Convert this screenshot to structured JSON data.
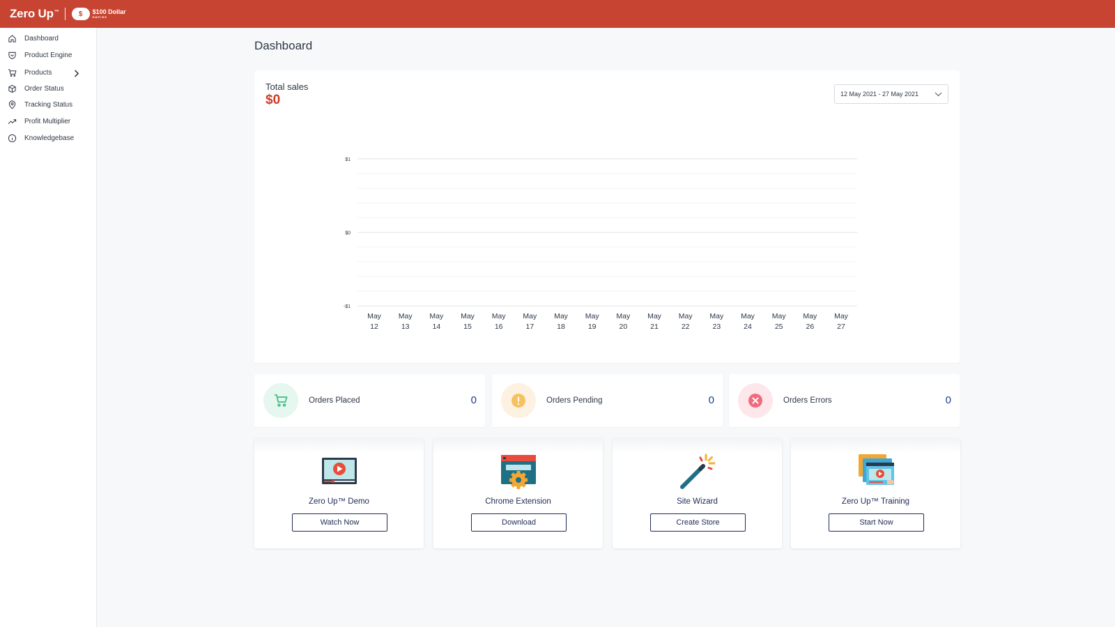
{
  "header": {
    "brand": "Zero Up",
    "brand_tm": "™",
    "partner_badge": "$",
    "partner_main": "$100 Dollar",
    "partner_sub": "EMPIRE",
    "bar_color": "#c84432"
  },
  "sidebar": {
    "items": [
      {
        "label": "Dashboard",
        "icon": "home-icon"
      },
      {
        "label": "Product Engine",
        "icon": "shield-icon"
      },
      {
        "label": "Products",
        "icon": "cart-icon"
      },
      {
        "label": "Order Status",
        "icon": "box-icon"
      },
      {
        "label": "Tracking Status",
        "icon": "location-pin-icon"
      },
      {
        "label": "Profit Multiplier",
        "icon": "trending-up-icon"
      },
      {
        "label": "Knowledgebase",
        "icon": "info-icon"
      }
    ]
  },
  "main": {
    "title": "Dashboard",
    "sales": {
      "label": "Total sales",
      "value": "$0",
      "date_range": "12 May 2021 - 27 May 2021"
    },
    "stats": [
      {
        "label": "Orders Placed",
        "value": "0",
        "icon": "cart-icon",
        "color": "#3fbf86",
        "bg": "#e6f7ef"
      },
      {
        "label": "Orders Pending",
        "value": "0",
        "icon": "exclamation-icon",
        "color": "#f3b750",
        "bg": "#fdf2e1"
      },
      {
        "label": "Orders Errors",
        "value": "0",
        "icon": "x-circle-icon",
        "color": "#f06c7d",
        "bg": "#fde7ea"
      }
    ],
    "features": [
      {
        "title": "Zero Up™ Demo",
        "button": "Watch Now",
        "icon": "video-player-icon"
      },
      {
        "title": "Chrome Extension",
        "button": "Download",
        "icon": "browser-gear-icon"
      },
      {
        "title": "Site Wizard",
        "button": "Create Store",
        "icon": "magic-wand-icon"
      },
      {
        "title": "Zero Up™ Training",
        "button": "Start Now",
        "icon": "training-video-icon"
      }
    ]
  },
  "chart_data": {
    "type": "line",
    "categories": [
      "May 12",
      "May 13",
      "May 14",
      "May 15",
      "May 16",
      "May 17",
      "May 18",
      "May 19",
      "May 20",
      "May 21",
      "May 22",
      "May 23",
      "May 24",
      "May 25",
      "May 26",
      "May 27"
    ],
    "series": [
      {
        "values": [
          0,
          0,
          0,
          0,
          0,
          0,
          0,
          0,
          0,
          0,
          0,
          0,
          0,
          0,
          0,
          0
        ]
      }
    ],
    "y_ticks": [
      "$1",
      "$0",
      "-$1"
    ],
    "ylim": [
      -1,
      1
    ],
    "grid": true
  }
}
